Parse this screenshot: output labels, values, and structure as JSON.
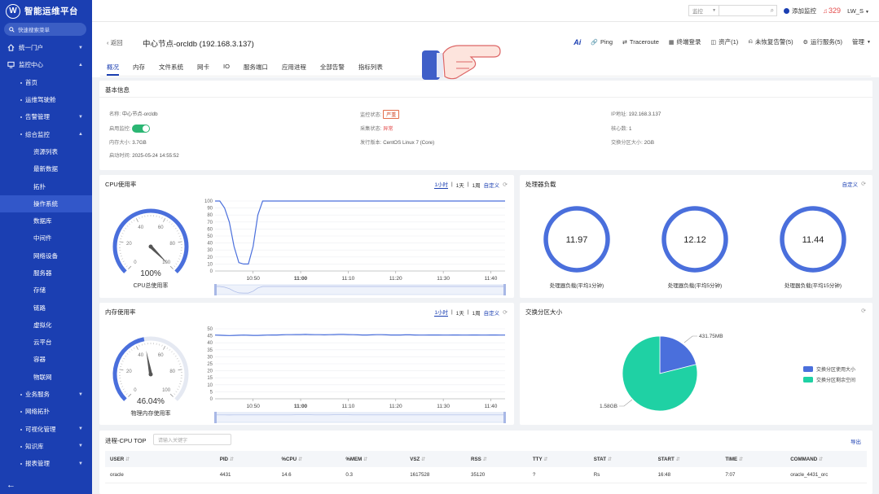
{
  "app": {
    "name": "智能运维平台",
    "logo_letter": "W"
  },
  "sidebar": {
    "search_placeholder": "快速搜索菜单",
    "items": [
      {
        "label": "统一门户",
        "level": "top",
        "arrow": true,
        "icon": "home-icon"
      },
      {
        "label": "监控中心",
        "level": "top",
        "arrow": true,
        "icon": "monitor-icon"
      },
      {
        "label": "首页",
        "level": "l1"
      },
      {
        "label": "运维驾驶舱",
        "level": "l1"
      },
      {
        "label": "告警管理",
        "level": "l1",
        "arrow": true
      },
      {
        "label": "综合监控",
        "level": "l1",
        "arrow": true
      },
      {
        "label": "资源列表",
        "level": "l2"
      },
      {
        "label": "最新数据",
        "level": "l2"
      },
      {
        "label": "拓扑",
        "level": "l2"
      },
      {
        "label": "操作系统",
        "level": "l2",
        "active": true
      },
      {
        "label": "数据库",
        "level": "l2"
      },
      {
        "label": "中间件",
        "level": "l2"
      },
      {
        "label": "网络设备",
        "level": "l2"
      },
      {
        "label": "服务器",
        "level": "l2"
      },
      {
        "label": "存储",
        "level": "l2"
      },
      {
        "label": "链路",
        "level": "l2"
      },
      {
        "label": "虚拟化",
        "level": "l2"
      },
      {
        "label": "云平台",
        "level": "l2"
      },
      {
        "label": "容器",
        "level": "l2"
      },
      {
        "label": "物联网",
        "level": "l2"
      },
      {
        "label": "业务服务",
        "level": "l1",
        "arrow": true
      },
      {
        "label": "网络拓扑",
        "level": "l1"
      },
      {
        "label": "可视化管理",
        "level": "l1",
        "arrow": true
      },
      {
        "label": "知识库",
        "level": "l1",
        "arrow": true
      },
      {
        "label": "报表管理",
        "level": "l1",
        "arrow": true
      }
    ],
    "collapse_icon": "arrow-left-icon"
  },
  "topbar": {
    "select_value": "监控",
    "add_monitor": "添加监控",
    "alert_count": "329",
    "user": "LW_S"
  },
  "header": {
    "back": "返回",
    "title": "中心节点-orcldb (192.168.3.137)",
    "actions": [
      "Ping",
      "Traceroute",
      "终端登录",
      "资产(1)",
      "未恢复告警(5)",
      "运行服务(5)",
      "管理"
    ],
    "ai_label": "Ai",
    "tabs": [
      "概况",
      "内存",
      "文件系统",
      "网卡",
      "IO",
      "服务端口",
      "应用进程",
      "全部告警",
      "指标列表"
    ]
  },
  "basic_info": {
    "title": "基本信息",
    "name_label": "名称:",
    "name_value": "中心节点-orcldb",
    "monitor_status_label": "监控状态:",
    "monitor_status_value": "严重",
    "ip_label": "IP地址:",
    "ip_value": "192.168.3.137",
    "enable_label": "启用监控:",
    "collect_label": "采集状态:",
    "collect_value": "异常",
    "cores_label": "核心数:",
    "cores_value": "1",
    "memory_label": "内存大小:",
    "memory_value": "3.7GB",
    "os_label": "发行版本:",
    "os_value": "CentOS Linux 7 (Core)",
    "swap_label": "交换分区大小:",
    "swap_value": "2GB",
    "boot_label": "启动时间:",
    "boot_value": "2025-05-24 14:55:52"
  },
  "ranges": {
    "h1": "1小时",
    "d1": "1天",
    "w1": "1周",
    "custom": "自定义"
  },
  "cpu_card": {
    "title": "CPU使用率",
    "gauge_value": "100%",
    "gauge_label": "CPU总使用率"
  },
  "load_card": {
    "title": "处理器负载",
    "custom": "自定义",
    "rings": [
      {
        "value": "11.97",
        "label": "处理器负载(平均1分钟)"
      },
      {
        "value": "12.12",
        "label": "处理器负载(平均5分钟)"
      },
      {
        "value": "11.44",
        "label": "处理器负载(平均15分钟)"
      }
    ]
  },
  "mem_card": {
    "title": "内存使用率",
    "gauge_value": "46.04%",
    "gauge_label": "物理内存使用率"
  },
  "swap_card": {
    "title": "交换分区大小",
    "legend": [
      "交换分区使用大小",
      "交换分区剩余空间"
    ],
    "used_label": "431.75MB",
    "free_label": "1.58GB",
    "colors": {
      "used": "#4a6fdc",
      "free": "#1fd1a4"
    }
  },
  "proc_card": {
    "title": "进程-CPU TOP",
    "search_placeholder": "请输入关键字",
    "export": "导出",
    "columns": [
      "USER",
      "PID",
      "%CPU",
      "%MEM",
      "VSZ",
      "RSS",
      "TTY",
      "STAT",
      "START",
      "TIME",
      "COMMAND"
    ],
    "rows": [
      [
        "oracle",
        "4431",
        "14.6",
        "0.3",
        "1617528",
        "35120",
        "?",
        "Rs",
        "16:48",
        "7:07",
        "oracle_4431_orc"
      ]
    ]
  },
  "chart_data": [
    {
      "type": "gauge",
      "name": "cpu",
      "value": 100,
      "min": 0,
      "max": 100,
      "ticks": [
        0,
        20,
        40,
        60,
        80,
        100
      ]
    },
    {
      "type": "line",
      "name": "cpu_trend",
      "x_ticks": [
        "10:50",
        "11:00",
        "11:10",
        "11:20",
        "11:30",
        "11:40"
      ],
      "ylim": [
        0,
        100
      ],
      "y_ticks": [
        0,
        10,
        20,
        30,
        40,
        50,
        60,
        70,
        80,
        90,
        100
      ],
      "series": [
        {
          "values": [
            100,
            100,
            90,
            70,
            35,
            12,
            10,
            10,
            35,
            80,
            100,
            100,
            100,
            100,
            100,
            100,
            100,
            100,
            100,
            100,
            100,
            100,
            100,
            100,
            100,
            100,
            100,
            100,
            100,
            100,
            100,
            100,
            100,
            100,
            100,
            100,
            100,
            100,
            100,
            100,
            100,
            100,
            100,
            100,
            100,
            100,
            100,
            100,
            100,
            100,
            100,
            100,
            100,
            100,
            100,
            100,
            100,
            100,
            100,
            100,
            100,
            100
          ]
        }
      ],
      "x_tick_index": [
        8,
        18,
        28,
        38,
        48,
        58
      ]
    },
    {
      "type": "gauge",
      "name": "memory",
      "value": 46.04,
      "min": 0,
      "max": 100,
      "ticks": [
        0,
        20,
        40,
        60,
        80,
        100
      ]
    },
    {
      "type": "line",
      "name": "memory_trend",
      "x_ticks": [
        "10:50",
        "11:00",
        "11:10",
        "11:20",
        "11:30",
        "11:40"
      ],
      "ylim": [
        0,
        50
      ],
      "y_ticks": [
        0,
        5,
        10,
        15,
        20,
        25,
        30,
        35,
        40,
        45,
        50
      ],
      "series": [
        {
          "values": [
            45.5,
            45.4,
            45.3,
            45.2,
            45.3,
            45.4,
            45.5,
            45.4,
            45.3,
            45.3,
            45.4,
            45.5,
            45.6,
            45.6,
            45.7,
            45.8,
            45.8,
            45.9,
            45.9,
            46.0,
            45.9,
            45.8,
            45.8,
            45.7,
            45.8,
            45.9,
            46.0,
            46.0,
            45.9,
            45.8,
            45.7,
            45.6,
            45.6,
            45.7,
            45.8,
            45.8,
            45.7,
            45.6,
            45.6,
            45.6,
            45.7,
            45.7,
            45.6,
            45.5,
            45.5,
            45.6,
            45.6,
            45.6,
            45.5,
            45.5,
            45.6,
            45.6,
            45.5,
            45.5,
            45.6,
            45.6,
            45.5,
            45.5,
            45.6,
            45.6,
            45.5,
            45.5
          ]
        }
      ],
      "x_tick_index": [
        8,
        18,
        28,
        38,
        48,
        58
      ]
    },
    {
      "type": "pie",
      "name": "swap",
      "labels": [
        "交换分区使用大小",
        "交换分区剩余空间"
      ],
      "values": [
        431.75,
        1617.9
      ]
    }
  ]
}
